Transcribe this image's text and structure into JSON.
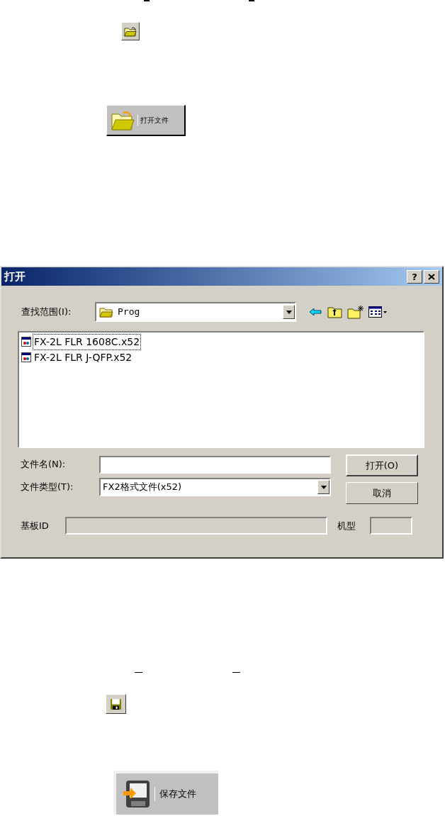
{
  "open_button": {
    "label": "打开文件"
  },
  "dialog": {
    "title": "打开",
    "help": "?",
    "look_in": {
      "label": "查找范围(I):",
      "value": "Prog"
    },
    "files": [
      {
        "name": "FX-2L FLR 1608C.x52",
        "focused": true
      },
      {
        "name": "FX-2L FLR J-QFP.x52",
        "focused": false
      }
    ],
    "file_name": {
      "label": "文件名(N):"
    },
    "file_type": {
      "label": "文件类型(T):",
      "value": "FX2格式文件(x52)"
    },
    "buttons": [
      "打开(O)",
      "取消"
    ],
    "board_id": {
      "label": "基板ID"
    },
    "model": {
      "label": "机型"
    }
  },
  "save_button": {
    "label": "保存文件"
  }
}
